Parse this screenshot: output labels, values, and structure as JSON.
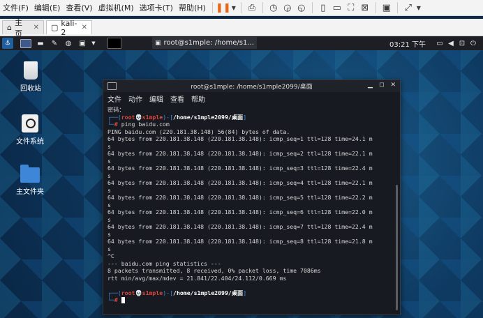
{
  "vm_menu": [
    "文件(F)",
    "编辑(E)",
    "查看(V)",
    "虚拟机(M)",
    "选项卡(T)",
    "帮助(H)"
  ],
  "tabs": [
    {
      "label": "主页",
      "icon": "home-icon"
    },
    {
      "label": "kali-2",
      "icon": "vm-icon"
    }
  ],
  "panel": {
    "task_title": "root@s1mple: /home/s1...",
    "clock": "03:21 下午"
  },
  "desktop_icons": [
    "回收站",
    "文件系统",
    "主文件夹"
  ],
  "terminal": {
    "title": "root@s1mple: /home/s1mple2099/桌面",
    "menu": [
      "文件",
      "动作",
      "编辑",
      "查看",
      "帮助"
    ],
    "password_prompt": "密码：",
    "prompt_user": "root",
    "prompt_host": "s1mple",
    "prompt_path": "/home/s1mple2099/桌面",
    "command": "ping baidu.com",
    "ping_header": "PING baidu.com (220.181.38.148) 56(84) bytes of data.",
    "ping_lines": [
      "64 bytes from 220.181.38.148 (220.181.38.148): icmp_seq=1 ttl=128 time=24.1 m",
      "64 bytes from 220.181.38.148 (220.181.38.148): icmp_seq=2 ttl=128 time=22.1 m",
      "64 bytes from 220.181.38.148 (220.181.38.148): icmp_seq=3 ttl=128 time=22.4 m",
      "64 bytes from 220.181.38.148 (220.181.38.148): icmp_seq=4 ttl=128 time=22.1 m",
      "64 bytes from 220.181.38.148 (220.181.38.148): icmp_seq=5 ttl=128 time=22.2 m",
      "64 bytes from 220.181.38.148 (220.181.38.148): icmp_seq=6 ttl=128 time=22.0 m",
      "64 bytes from 220.181.38.148 (220.181.38.148): icmp_seq=7 ttl=128 time=22.4 m",
      "64 bytes from 220.181.38.148 (220.181.38.148): icmp_seq=8 ttl=128 time=21.8 m"
    ],
    "wrap_char": "s",
    "interrupt": "^C",
    "stats_header": "--- baidu.com ping statistics ---",
    "stats_packets": "8 packets transmitted, 8 received, 0% packet loss, time 7086ms",
    "stats_rtt": "rtt min/avg/max/mdev = 21.841/22.404/24.112/0.669 ms"
  }
}
